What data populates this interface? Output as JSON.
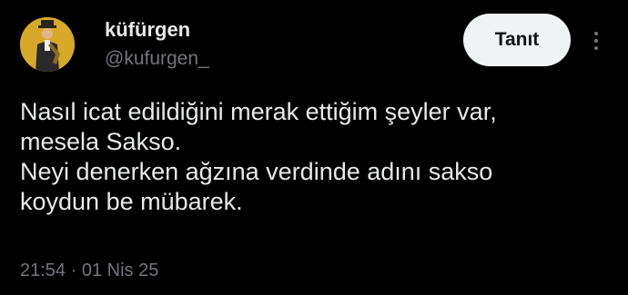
{
  "author": {
    "display_name": "küfürgen",
    "handle": "@kufurgen_",
    "avatar_icon": "profile-photo"
  },
  "follow_button": {
    "label": "Tanıt"
  },
  "more_button": {
    "icon": "more-vertical-icon"
  },
  "tweet": {
    "lines": [
      "Nasıl icat edildiğini merak ettiğim şeyler var,",
      "mesela Sakso.",
      "Neyi denerken ağzına verdinde adını sakso",
      "koydun be mübarek."
    ]
  },
  "meta": {
    "timestamp": "21:54 · 01 Nis 25"
  },
  "colors": {
    "background": "#000000",
    "text_primary": "#e7e9ea",
    "text_secondary": "#71767b",
    "button_bg": "#eff3f4",
    "button_text": "#0f1419"
  }
}
